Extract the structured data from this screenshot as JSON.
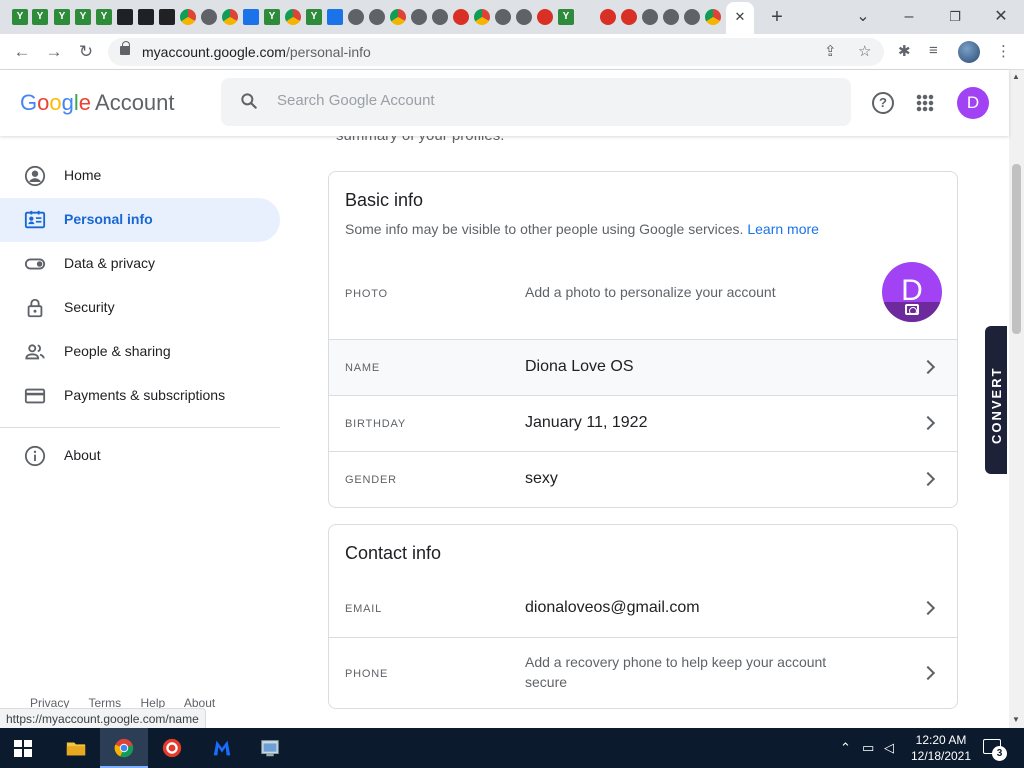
{
  "browser": {
    "url_host": "myaccount.google.com",
    "url_path": "/personal-info",
    "active_tab_favicon": "google-g-icon",
    "new_tab_label": "+",
    "close_tab_label": "✕",
    "status_url": "https://myaccount.google.com/name"
  },
  "header": {
    "logo_word": "Google",
    "logo_suffix": "Account",
    "search_placeholder": "Search Google Account",
    "avatar_letter": "D",
    "help_glyph": "?"
  },
  "sidebar": {
    "items": [
      {
        "label": "Home",
        "icon": "account-circle-icon"
      },
      {
        "label": "Personal info",
        "icon": "id-card-icon",
        "active": true
      },
      {
        "label": "Data & privacy",
        "icon": "toggle-icon"
      },
      {
        "label": "Security",
        "icon": "lock-icon"
      },
      {
        "label": "People & sharing",
        "icon": "people-icon"
      },
      {
        "label": "Payments & subscriptions",
        "icon": "credit-card-icon"
      },
      {
        "label": "About",
        "icon": "info-icon"
      }
    ],
    "footer": [
      "Privacy",
      "Terms",
      "Help",
      "About"
    ]
  },
  "main": {
    "summary_text": "summary of your profiles.",
    "basic_info": {
      "title": "Basic info",
      "subtitle": "Some info may be visible to other people using Google services.",
      "learn_more": "Learn more",
      "photo_label": "PHOTO",
      "photo_hint": "Add a photo to personalize your account",
      "photo_letter": "D",
      "rows": [
        {
          "label": "NAME",
          "value": "Diona Love OS"
        },
        {
          "label": "BIRTHDAY",
          "value": "January 11, 1922"
        },
        {
          "label": "GENDER",
          "value": "sexy"
        }
      ]
    },
    "contact_info": {
      "title": "Contact info",
      "email_label": "EMAIL",
      "email_value": "dionaloveos@gmail.com",
      "phone_label": "PHONE",
      "phone_hint": "Add a recovery phone to help keep your account secure"
    }
  },
  "convert_widget": {
    "label": "CONVERT"
  },
  "taskbar": {
    "time": "12:20 AM",
    "date": "12/18/2021",
    "notification_count": "3"
  },
  "colors": {
    "accent": "#1a73e8",
    "active_nav_bg": "#e8f0fe",
    "avatar": "#a142f4"
  }
}
